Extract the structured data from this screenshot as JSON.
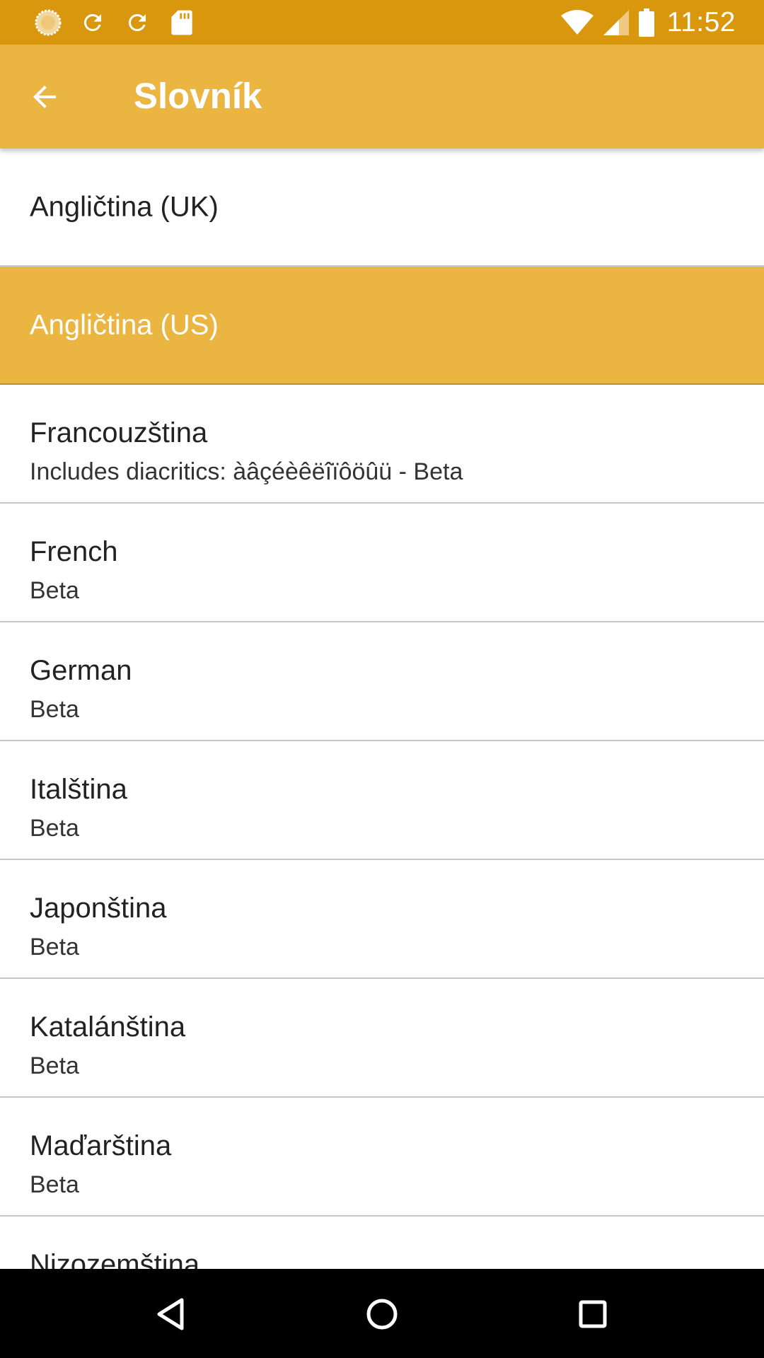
{
  "status_bar": {
    "time": "11:52",
    "left_icons": [
      "sync-circle-icon",
      "refresh-icon",
      "refresh-icon",
      "sd-card-icon"
    ],
    "right_icons": [
      "wifi-icon",
      "cell-signal-icon",
      "battery-icon"
    ],
    "background": "#d9970e"
  },
  "app_bar": {
    "title": "Slovník",
    "back_icon": "arrow-back-icon",
    "background": "#ebb541"
  },
  "list": {
    "items": [
      {
        "title": "Angličtina (UK)",
        "subtitle": "",
        "selected": false
      },
      {
        "title": "Angličtina (US)",
        "subtitle": "",
        "selected": true
      },
      {
        "title": "Francouzština",
        "subtitle": "Includes diacritics: àâçéèêëîïôöûü - Beta",
        "selected": false
      },
      {
        "title": "French",
        "subtitle": "Beta",
        "selected": false
      },
      {
        "title": "German",
        "subtitle": "Beta",
        "selected": false
      },
      {
        "title": "Italština",
        "subtitle": "Beta",
        "selected": false
      },
      {
        "title": "Japonština",
        "subtitle": "Beta",
        "selected": false
      },
      {
        "title": "Katalánština",
        "subtitle": "Beta",
        "selected": false
      },
      {
        "title": "Maďarština",
        "subtitle": "Beta",
        "selected": false
      },
      {
        "title": "Nizozemština",
        "subtitle": "",
        "selected": false
      }
    ],
    "selected_color": "#ebb541"
  },
  "nav_bar": {
    "icons": [
      "back-triangle-icon",
      "home-circle-icon",
      "recents-square-icon"
    ]
  }
}
